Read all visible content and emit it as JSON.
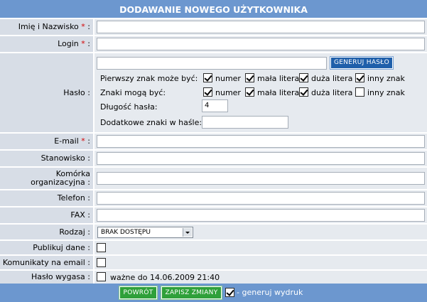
{
  "form": {
    "title": "DODAWANIE NOWEGO UŻYTKOWNIKA",
    "fields": {
      "full_name_label": "Imię i Nazwisko",
      "login_label": "Login",
      "password_label": "Hasło :",
      "email_label": "E-mail",
      "position_label": "Stanowisko :",
      "unit_label": "Komórka organizacyjna :",
      "phone_label": "Telefon :",
      "fax_label": "FAX :",
      "type_label": "Rodzaj :",
      "publish_label": "Publikuj dane :",
      "email_notif_label": "Komunikaty na email :",
      "expire_label": "Hasło wygasa :",
      "required_mark": "*",
      "colon": ":"
    },
    "password": {
      "generate_button": "GENERUJ HASŁO",
      "first_char_label": "Pierwszy znak może być:",
      "chars_label": "Znaki mogą być:",
      "length_label": "Długość hasła:",
      "length_value": "4",
      "extra_label": "Dodatkowe znaki w haśle:",
      "options": [
        "numer",
        "mała litera",
        "duża litera",
        "inny znak"
      ],
      "first_char_checked": [
        true,
        true,
        true,
        true
      ],
      "chars_checked": [
        true,
        true,
        true,
        false
      ]
    },
    "type_select": {
      "value": "BRAK DOSTĘPU"
    },
    "expire_text": "ważne do 14.06.2009 21:40",
    "footer": {
      "back_button": "POWRÓT",
      "save_button": "ZAPISZ ZMIANY",
      "print_text": "- generuj wydruk"
    }
  }
}
